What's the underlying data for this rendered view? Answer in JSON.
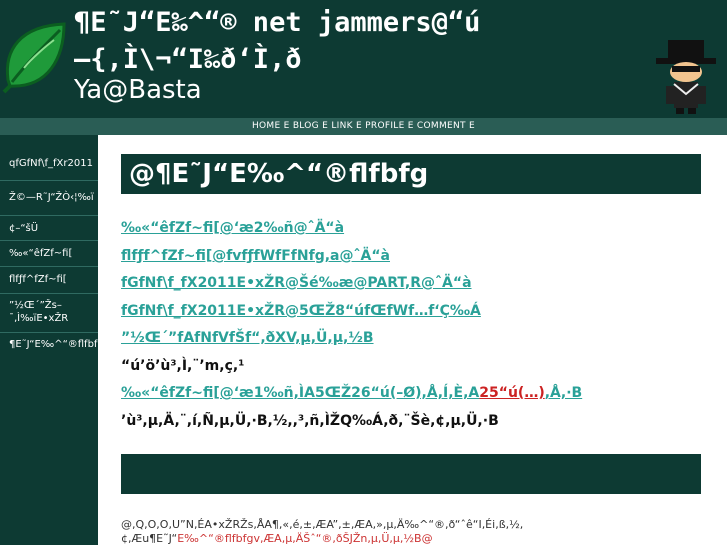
{
  "header": {
    "title": "¶E˜J“E‰^“® net jammers@“ú\n–{,Ì\\¬“I‰ð‘Ì,ð",
    "subtitle": "Ya@Basta"
  },
  "nav": {
    "links": [
      "HOME",
      "BLOG",
      "LINK",
      "PROFILE",
      "COMMENT"
    ],
    "separator": "E"
  },
  "sidebar": {
    "items": [
      "qfGfNf\\f_fXr2011",
      "Ž©—R˜J“ŽÒ‹¦‰ï",
      "¢–“šÜ",
      "‰«“êfZf~fi[",
      "flfƒf^fZf~fi[",
      "”½Œ´”Žs–¯‚Ì‰ïE•xŽR",
      "¶E˜J“E‰^“®flfbfg"
    ]
  },
  "main": {
    "title": "@¶E˜J“E‰^“®flfbfg",
    "lines": [
      {
        "text": "‰«“êfZf~fi[@‘æ2‰ñ@ˆÄ“à",
        "link": true
      },
      {
        "text": "flfƒf^fZf~fi[@fvfƒfWfFfNfg,a@ˆÄ“à",
        "link": true
      },
      {
        "text": "fGfNf\\f_fX2011E•xŽR@Šé‰æ@PART,R@ˆÄ“à",
        "link": true
      },
      {
        "text": "fGfNf\\f_fX2011E•xŽR@5ŒŽ8“úfŒfWf…f‘Ç‰Á",
        "link": true
      },
      {
        "text": "”½Œ´”fAfNfVfŠf“,ðXV,µ,Ü,µ,½B",
        "link": true
      },
      {
        "text": "“ú’ö’ù³,Ì,¨’m,ç,¹",
        "link": false
      }
    ],
    "mixed_line": {
      "before": "‰«“êfZf~fi[@‘æ1‰ñ,ÌA5ŒŽ26“ú(–Ø),Å,Í,È,A",
      "red": "25“ú(…)",
      "after": ",Å,·B"
    },
    "last_line": "’ù³,µ,Ä,¨,í,Ñ,µ,Ü,·B,½,,³,ñ,ÌŽQ‰Á,ð,¨Šè,¢,µ,Ü,·B"
  },
  "footer": {
    "text": "@,Q,O,O,U”N,ÉA•xŽRŽs,ÅA¶,«,é,±,ÆA”,±,ÆA,»,µ,Ä‰^“®,ð“ˆê“I,Éi,ß,½,¢,Æu¶E˜J“",
    "red": "E‰^“®flfbfgv,ÆA,µ,ÄŠˆ“®,ðŠJŽn,µ,Ü,µ,½B@"
  },
  "colors": {
    "dark_green": "#0d3a33",
    "nav_green": "#2a5d55",
    "link_teal": "#2aa198",
    "accent_red": "#cc2222"
  },
  "icons": {
    "logo": "leaf-icon",
    "mascot": "spy-character-icon"
  }
}
